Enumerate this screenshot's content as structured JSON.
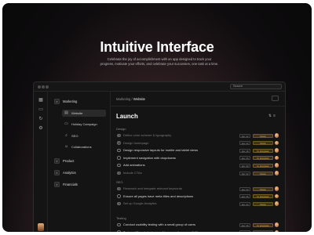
{
  "hero": {
    "title": "Intuitive Interface",
    "subtitle_line1": "Celebrate the joy of accomplishment with an app designed to track your",
    "subtitle_line2": "progress, motivate your efforts, and celebrate your successes, one task at a time."
  },
  "search": {
    "placeholder": "Search"
  },
  "sidebar": {
    "sections": [
      {
        "label": "Marketing",
        "icon": "folder-icon"
      },
      {
        "label": "Product",
        "icon": "folder-icon"
      },
      {
        "label": "Analytics",
        "icon": "folder-icon"
      },
      {
        "label": "Financials",
        "icon": "folder-icon"
      }
    ],
    "items": [
      {
        "label": "Website",
        "icon": "layout-icon",
        "active": true
      },
      {
        "label": "Holiday Campaign",
        "icon": "calendar-icon",
        "active": false
      },
      {
        "label": "SEO",
        "icon": "search-icon",
        "active": false
      },
      {
        "label": "Collaborations",
        "icon": "users-icon",
        "active": false
      }
    ]
  },
  "breadcrumb": {
    "parent": "Marketing",
    "sep": " / ",
    "current": "Website"
  },
  "page": {
    "title": "Launch"
  },
  "groups": [
    {
      "name": "Design",
      "tasks": [
        {
          "label": "Define color scheme & typography",
          "done": true,
          "date": "Apr 12",
          "status": "Done",
          "status_kind": "done"
        },
        {
          "label": "Design homepage",
          "done": true,
          "date": "Apr 12",
          "status": "Done",
          "status_kind": "done"
        },
        {
          "label": "Design responsive layouts for mobile and tablet views",
          "done": false,
          "date": "Apr 16",
          "status": "In progress",
          "status_kind": "prog"
        },
        {
          "label": "Implement navigation with dropdowns",
          "done": false,
          "date": "Apr 16",
          "status": "In progress",
          "status_kind": "prog"
        },
        {
          "label": "Add animations",
          "done": false,
          "date": "Apr 20",
          "status": "In progress",
          "status_kind": "prog"
        },
        {
          "label": "Include CTAs",
          "done": true,
          "date": "Apr 12",
          "status": "Done",
          "status_kind": "done"
        }
      ]
    },
    {
      "name": "SEO",
      "tasks": [
        {
          "label": "Research and integrate relevant keywords",
          "done": true,
          "date": "Apr 12",
          "status": "Done",
          "status_kind": "done"
        },
        {
          "label": "Ensure all pages have meta titles and descriptions",
          "done": false,
          "date": "Apr 16",
          "status": "In progress",
          "status_kind": "prog"
        },
        {
          "label": "Set up Google Analytics",
          "done": true,
          "date": "Apr 12",
          "status": "Done",
          "status_kind": "done"
        }
      ]
    },
    {
      "name": "Testing",
      "tasks": [
        {
          "label": "Conduct usability testing with a small group of users",
          "done": false,
          "date": "Apr 16",
          "status": "In progress",
          "status_kind": "prog"
        },
        {
          "label": "Test on different devices and browsers for compatibility",
          "done": false,
          "date": "Apr 20",
          "status": "To do",
          "status_kind": "todo"
        }
      ]
    }
  ],
  "colors": {
    "accent_status": "#e8b43d",
    "background": "#0e0c0e",
    "glow": "#b0857f"
  }
}
